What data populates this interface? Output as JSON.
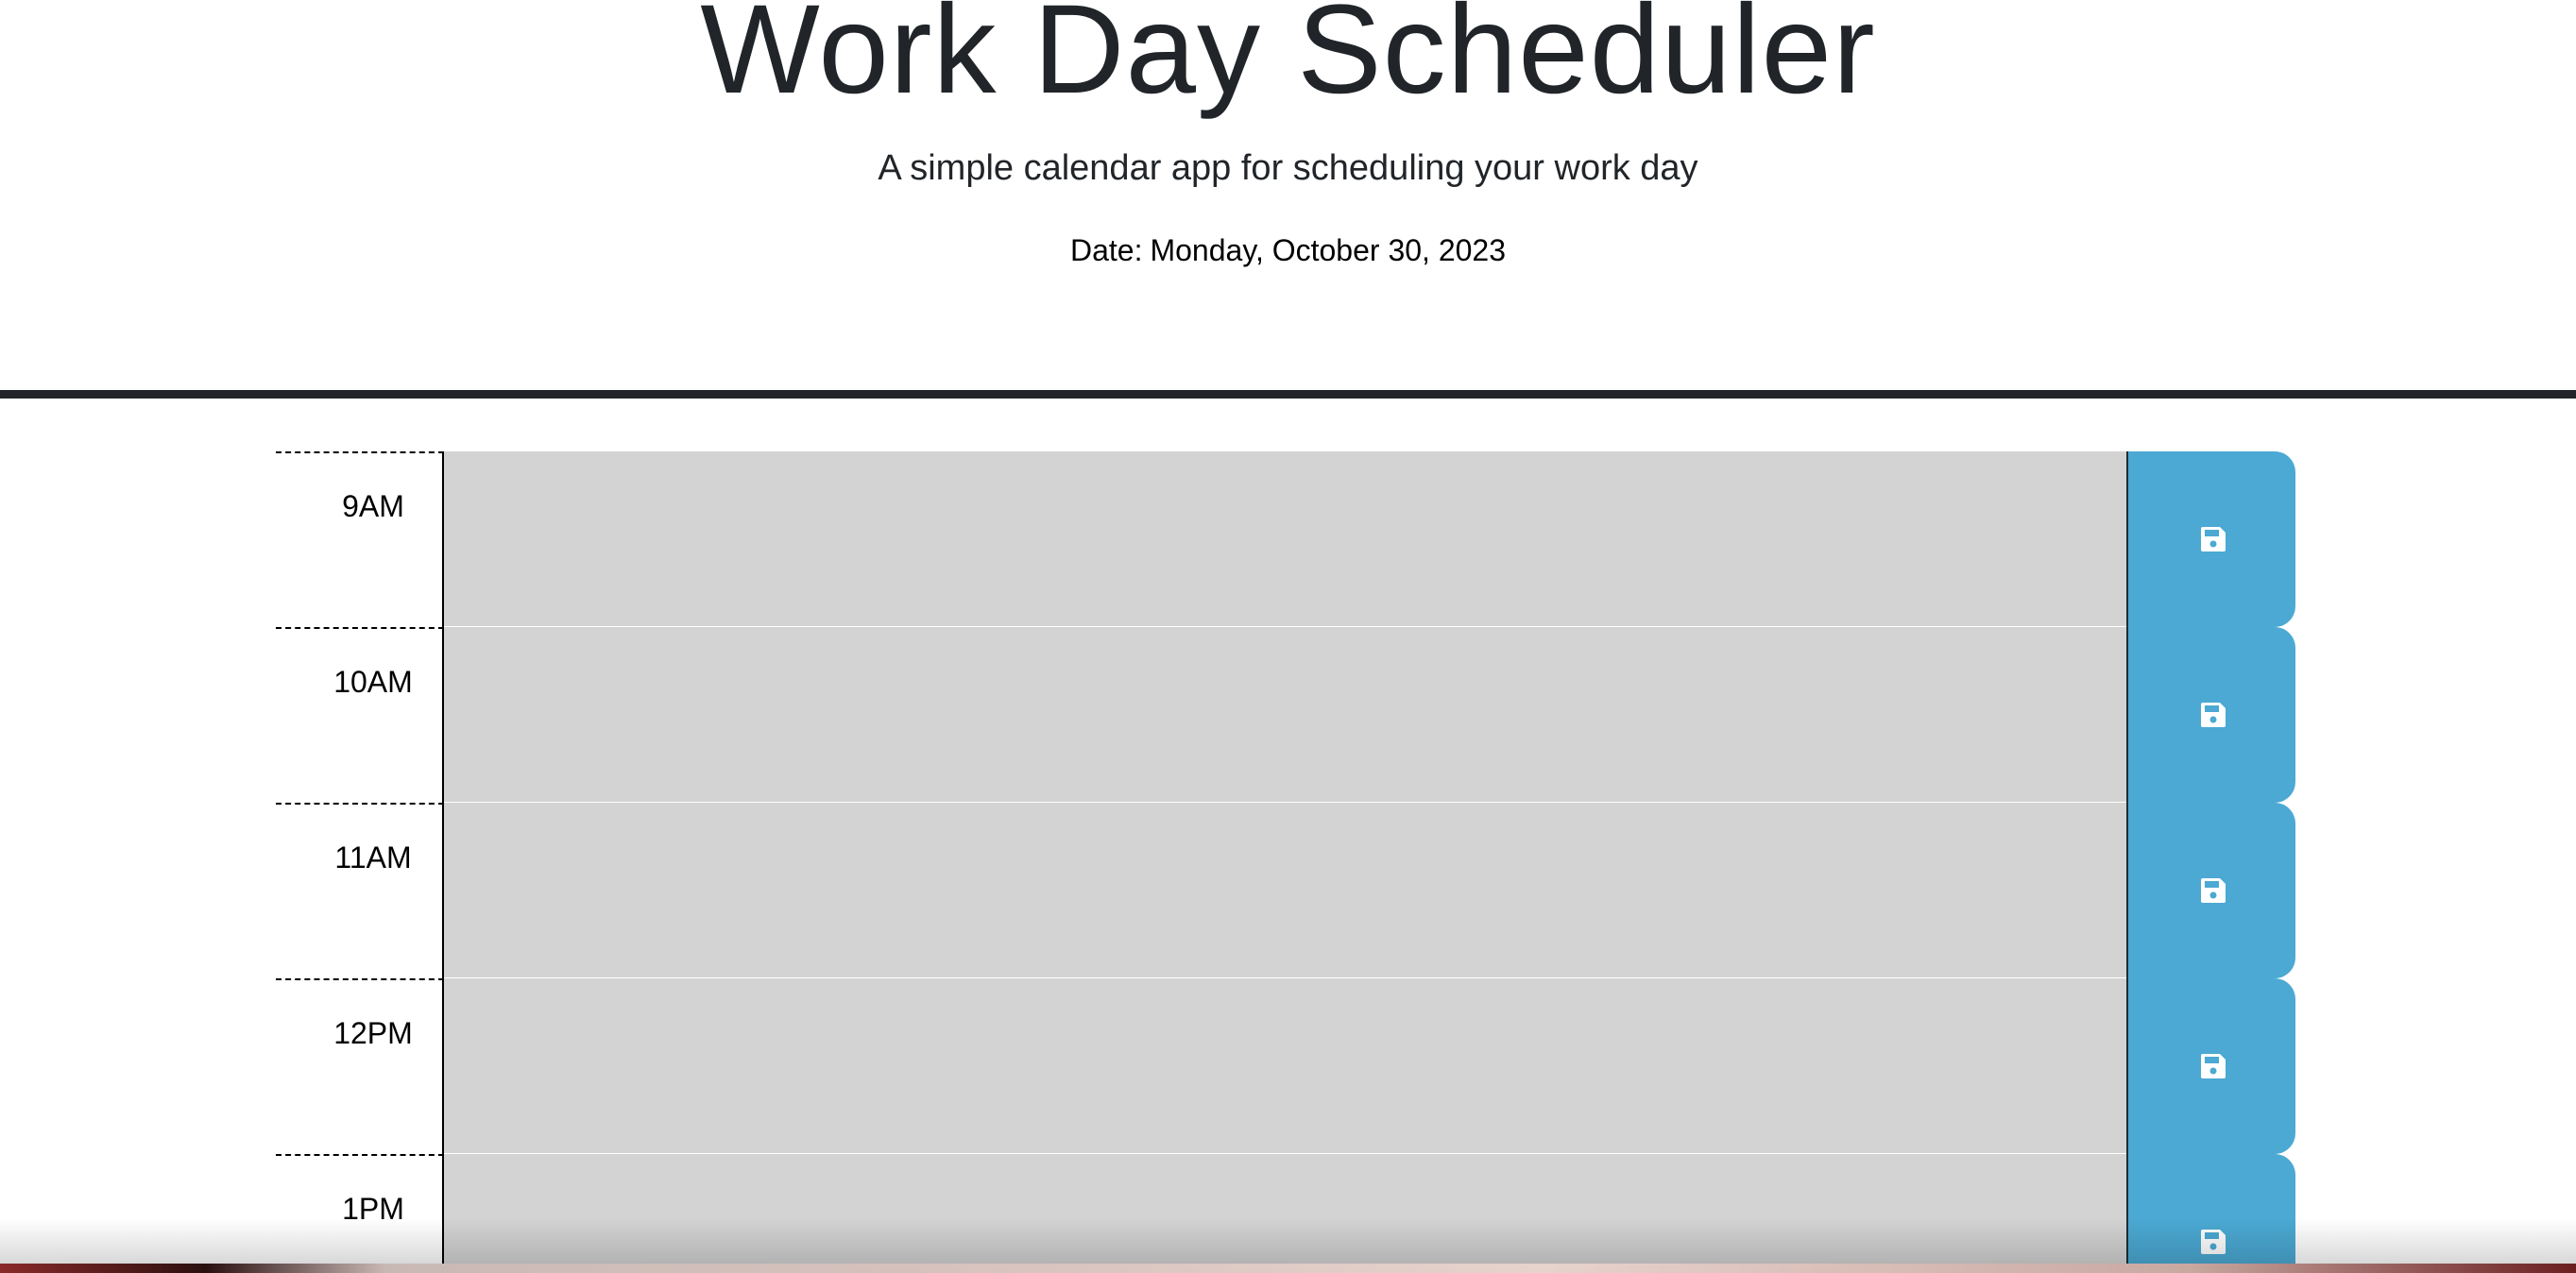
{
  "header": {
    "title": "Work Day Scheduler",
    "subtitle": "A simple calendar app for scheduling your work day",
    "date_prefix": "Date:",
    "date_value": "Monday, October 30, 2023"
  },
  "time_blocks": [
    {
      "hour": "9AM",
      "description": ""
    },
    {
      "hour": "10AM",
      "description": ""
    },
    {
      "hour": "11AM",
      "description": ""
    },
    {
      "hour": "12PM",
      "description": ""
    },
    {
      "hour": "1PM",
      "description": ""
    }
  ],
  "icons": {
    "save": "floppy-disk-icon"
  },
  "colors": {
    "past_block": "#d3d3d3",
    "save_button": "#4ba9d3",
    "save_icon": "#ffffff",
    "header_rule": "#212529"
  }
}
